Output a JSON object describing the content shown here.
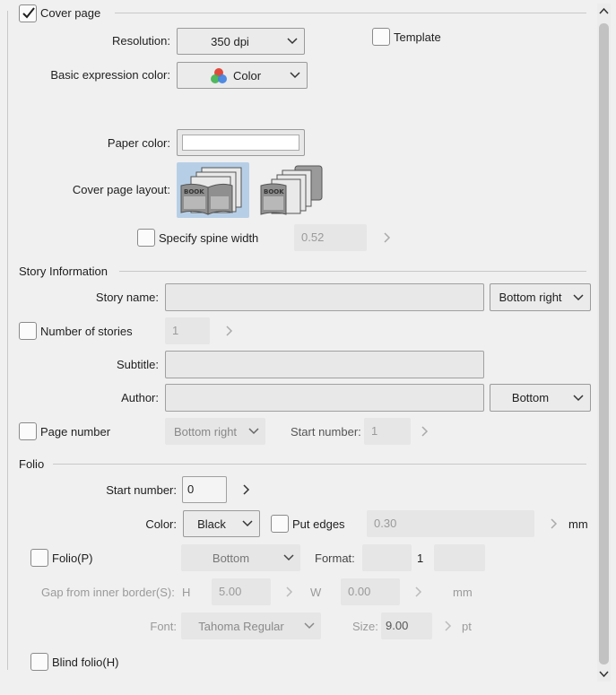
{
  "cover": {
    "checkbox_label": "Cover page",
    "checked": true,
    "resolution_label": "Resolution:",
    "resolution_value": "350 dpi",
    "template_label": "Template",
    "expression_label": "Basic expression color:",
    "expression_value": "Color",
    "paper_label": "Paper color:",
    "paper_color": "#ffffff",
    "layout_label": "Cover page layout:",
    "layout_icon_text": "BOOK",
    "spine_label": "Specify spine width",
    "spine_value": "0.52"
  },
  "story": {
    "section_label": "Story Information",
    "name_label": "Story name:",
    "name_value": "",
    "name_position": "Bottom right",
    "number_label": "Number of stories",
    "number_value": "1",
    "subtitle_label": "Subtitle:",
    "subtitle_value": "",
    "author_label": "Author:",
    "author_value": "",
    "author_position": "Bottom",
    "page_number_label": "Page number",
    "page_number_position": "Bottom right",
    "start_number_label": "Start number:",
    "start_number_value": "1"
  },
  "folio": {
    "section_label": "Folio",
    "start_label": "Start number:",
    "start_value": "0",
    "color_label": "Color:",
    "color_value": "Black",
    "put_edges_label": "Put edges",
    "edges_value": "0.30",
    "edges_unit": "mm",
    "folio_label": "Folio(P)",
    "folio_position": "Bottom",
    "format_label": "Format:",
    "format_value": "1",
    "gap_label": "Gap from inner border(S):",
    "gap_h_label": "H",
    "gap_h_value": "5.00",
    "gap_w_label": "W",
    "gap_w_value": "0.00",
    "gap_unit": "mm",
    "font_label": "Font:",
    "font_value": "Tahoma Regular",
    "size_label": "Size:",
    "size_value": "9.00",
    "size_unit": "pt",
    "blind_label": "Blind folio(H)"
  },
  "colors": {
    "accent_selected": "#b7cfe6",
    "panel_bg": "#f0f0f0"
  }
}
